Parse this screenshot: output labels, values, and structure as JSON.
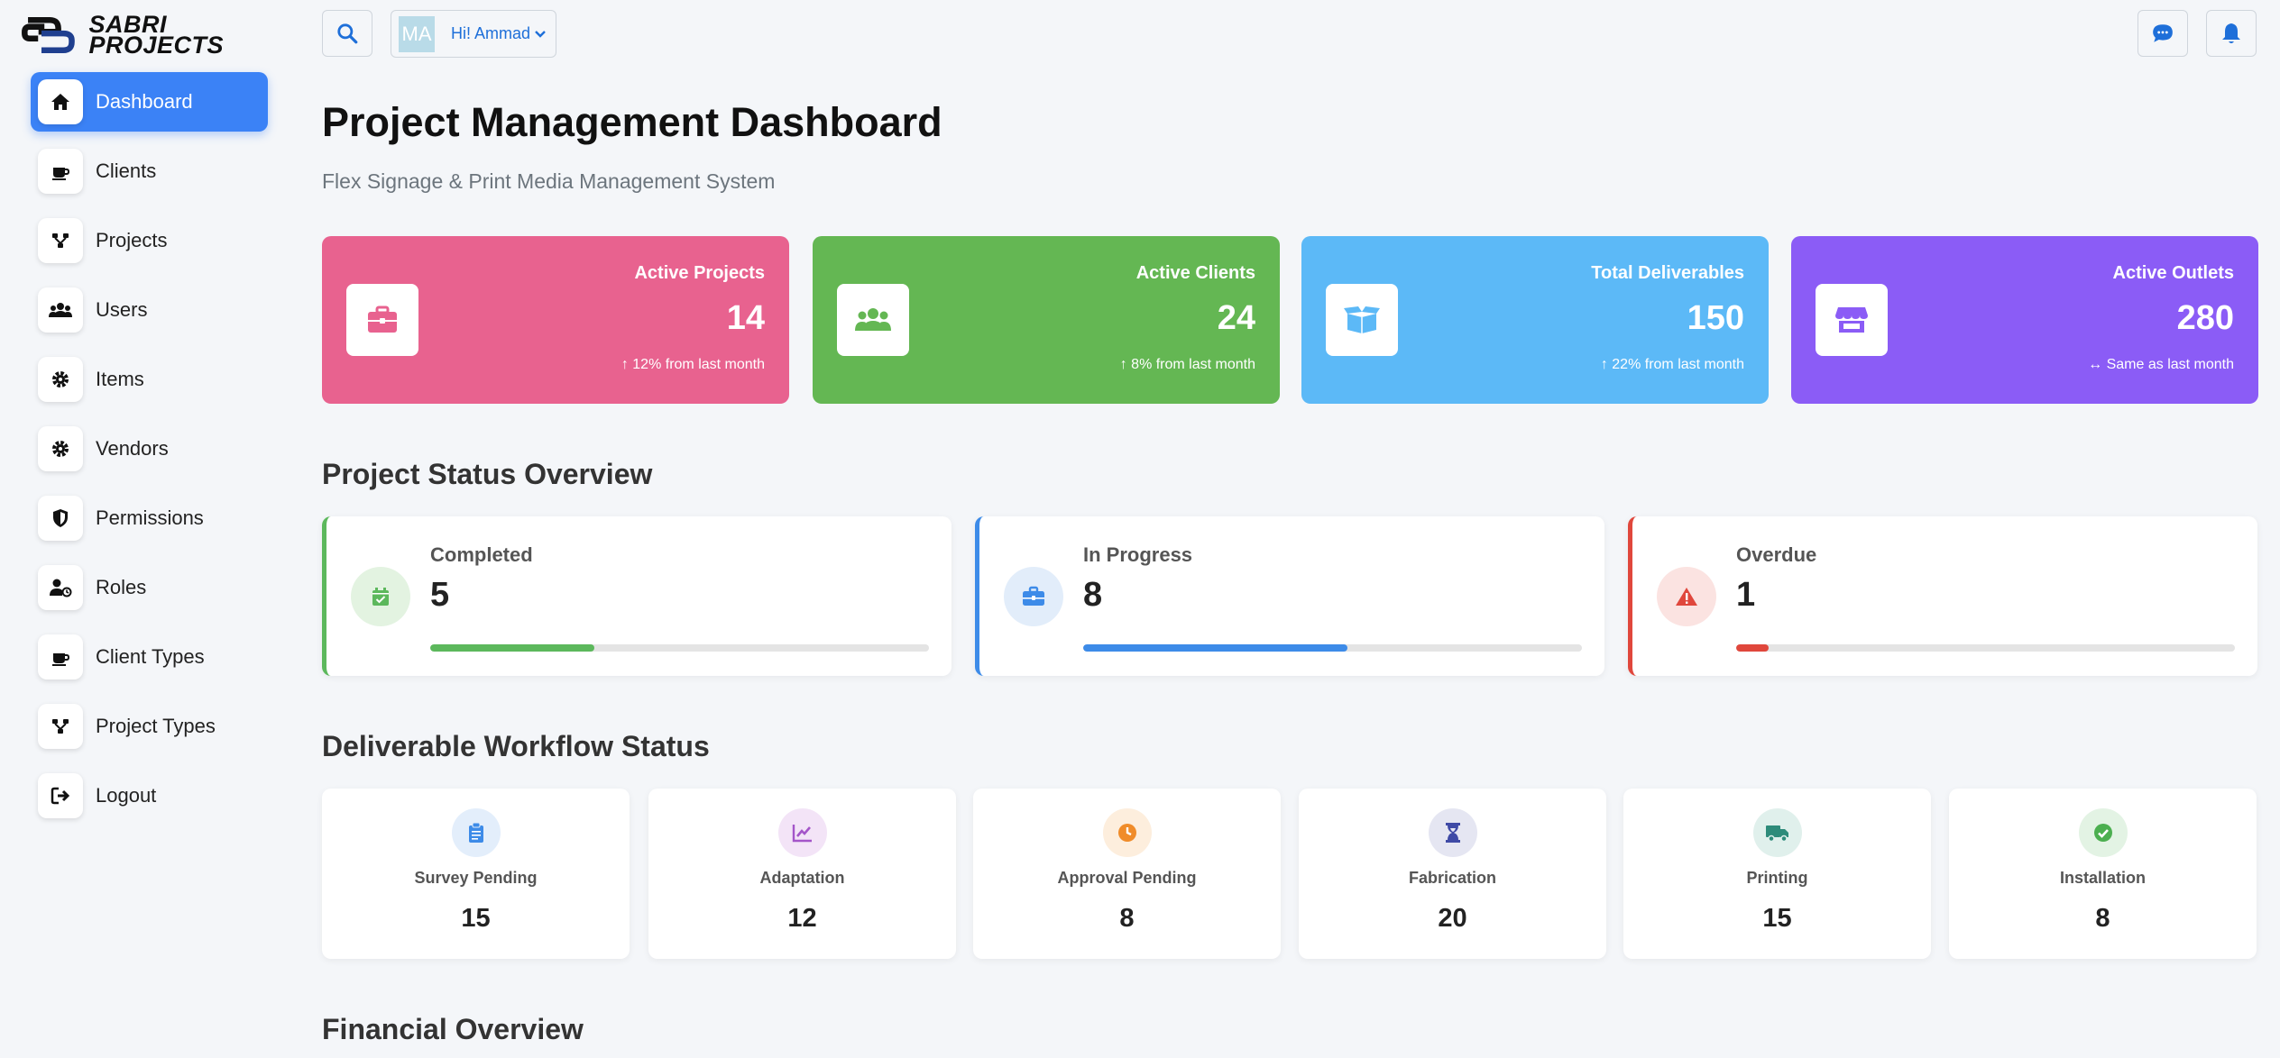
{
  "brand": {
    "line1": "SABRI",
    "line2": "PROJECTS"
  },
  "sidebar": {
    "items": [
      {
        "label": "Dashboard",
        "icon": "home-icon",
        "active": true
      },
      {
        "label": "Clients",
        "icon": "coffee-icon"
      },
      {
        "label": "Projects",
        "icon": "sitemap-icon"
      },
      {
        "label": "Users",
        "icon": "users-icon"
      },
      {
        "label": "Items",
        "icon": "gear-icon"
      },
      {
        "label": "Vendors",
        "icon": "gear-icon"
      },
      {
        "label": "Permissions",
        "icon": "shield-icon"
      },
      {
        "label": "Roles",
        "icon": "user-lock-icon"
      },
      {
        "label": "Client Types",
        "icon": "coffee-icon"
      },
      {
        "label": "Project Types",
        "icon": "sitemap-icon"
      },
      {
        "label": "Logout",
        "icon": "logout-icon"
      }
    ]
  },
  "topbar": {
    "avatar_initials": "MA",
    "greeting": "Hi! Ammad"
  },
  "header": {
    "title": "Project Management Dashboard",
    "subtitle": "Flex Signage & Print Media Management System"
  },
  "stats": [
    {
      "title": "Active Projects",
      "value": "14",
      "change": "↑ 12% from last month",
      "color": "#e8628f",
      "icon": "briefcase-icon"
    },
    {
      "title": "Active Clients",
      "value": "24",
      "change": "↑ 8% from last month",
      "color": "#64b753",
      "icon": "users-icon"
    },
    {
      "title": "Total Deliverables",
      "value": "150",
      "change": "↑ 22% from last month",
      "color": "#5cb9f7",
      "icon": "box-open-icon"
    },
    {
      "title": "Active Outlets",
      "value": "280",
      "change": "↔ Same as last month",
      "color": "#8b5cf6",
      "icon": "store-icon"
    }
  ],
  "status_overview": {
    "title": "Project Status Overview",
    "items": [
      {
        "label": "Completed",
        "value": "5",
        "color": "#5cb85c",
        "progress": 0.33,
        "icon": "calendar-check-icon"
      },
      {
        "label": "In Progress",
        "value": "8",
        "color": "#3d8be8",
        "progress": 0.53,
        "icon": "briefcase-icon"
      },
      {
        "label": "Overdue",
        "value": "1",
        "color": "#e0473c",
        "progress": 0.066,
        "icon": "warning-icon"
      }
    ]
  },
  "workflow": {
    "title": "Deliverable Workflow Status",
    "items": [
      {
        "label": "Survey Pending",
        "value": "15",
        "color": "#3d8be8",
        "bg": "#e3eefb",
        "icon": "clipboard-icon"
      },
      {
        "label": "Adaptation",
        "value": "12",
        "color": "#a455c9",
        "bg": "#f3e4f7",
        "icon": "chart-line-icon"
      },
      {
        "label": "Approval Pending",
        "value": "8",
        "color": "#f08c2a",
        "bg": "#fdeedd",
        "icon": "clock-icon"
      },
      {
        "label": "Fabrication",
        "value": "20",
        "color": "#3f4aa6",
        "bg": "#e5e6f2",
        "icon": "hourglass-icon"
      },
      {
        "label": "Printing",
        "value": "15",
        "color": "#2e8b7a",
        "bg": "#e0f0ec",
        "icon": "truck-icon"
      },
      {
        "label": "Installation",
        "value": "8",
        "color": "#4caf50",
        "bg": "#e3f3e4",
        "icon": "check-circle-icon"
      }
    ]
  },
  "financial": {
    "title": "Financial Overview"
  }
}
